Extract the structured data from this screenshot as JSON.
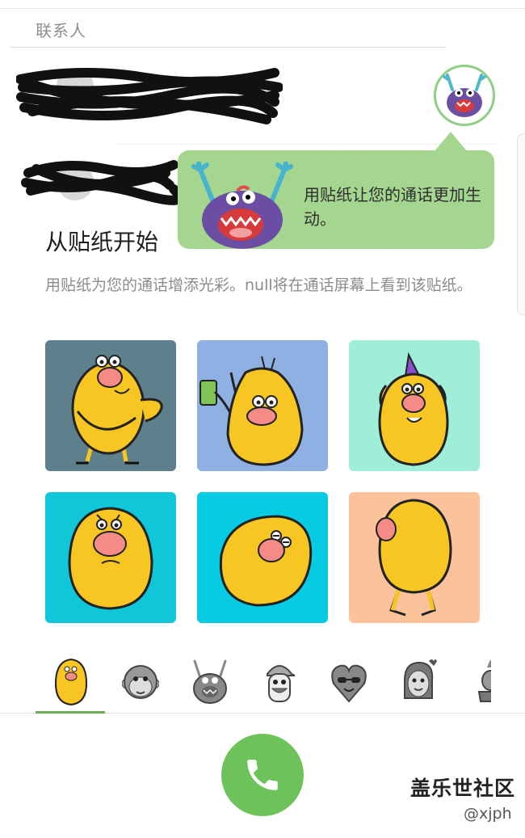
{
  "contacts_section": {
    "header": "联系人"
  },
  "tooltip": {
    "text": "用贴纸让您的通话更加生动。"
  },
  "intro": {
    "title": "从贴纸开始",
    "description": "用贴纸为您的通话增添光彩。null将在通话屏幕上看到该贴纸。"
  },
  "stickers": {
    "tiles": [
      {
        "icon": "potato-waving-sticker",
        "bg": "#5e7f8c"
      },
      {
        "icon": "potato-phone-sticker",
        "bg": "#8fb0e3"
      },
      {
        "icon": "potato-party-hat-sticker",
        "bg": "#9eeed8"
      },
      {
        "icon": "potato-worried-sticker",
        "bg": "#0fc7d8"
      },
      {
        "icon": "potato-lying-sticker",
        "bg": "#07cbe2"
      },
      {
        "icon": "potato-back-sticker",
        "bg": "#fcc39b"
      }
    ]
  },
  "sticker_tabs": [
    {
      "icon": "potato-pack-icon",
      "selected": true
    },
    {
      "icon": "monkey-pack-icon",
      "selected": false
    },
    {
      "icon": "monster-pack-icon",
      "selected": false
    },
    {
      "icon": "cap-guy-pack-icon",
      "selected": false
    },
    {
      "icon": "heart-sunglasses-pack-icon",
      "selected": false
    },
    {
      "icon": "lady-pack-icon",
      "selected": false
    },
    {
      "icon": "cat-pack-icon",
      "selected": false
    }
  ],
  "watermark": {
    "site": "盖乐世社区",
    "user": "@xjph"
  },
  "colors": {
    "accent_green": "#6ec25a",
    "tooltip_green": "#a4d690",
    "potato_yellow": "#f7c623",
    "nose_pink": "#f58b86"
  }
}
